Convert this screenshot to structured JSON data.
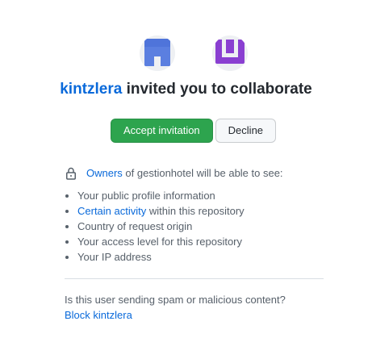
{
  "inviter": {
    "username": "kintzlera",
    "avatar_icon": "identicon-blue",
    "avatar_color": "#5b7fe0"
  },
  "organization": {
    "avatar_icon": "identicon-purple",
    "avatar_color": "#8a3fd1"
  },
  "headline": {
    "username": "kintzlera",
    "text": "invited you to collaborate"
  },
  "actions": {
    "accept_label": "Accept invitation",
    "decline_label": "Decline"
  },
  "visibility": {
    "icon": "lock-icon",
    "owners_link": "Owners",
    "text": "of gestionhotel will be able to see:"
  },
  "permissions": [
    {
      "text": "Your public profile information"
    },
    {
      "link": "Certain activity",
      "text": "within this repository"
    },
    {
      "text": "Country of request origin"
    },
    {
      "text": "Your access level for this repository"
    },
    {
      "text": "Your IP address"
    }
  ],
  "report": {
    "question": "Is this user sending spam or malicious content?",
    "block_link": "Block kintzlera"
  },
  "colors": {
    "link": "#0969da",
    "primary_button": "#2da44e",
    "muted_text": "#57606a"
  }
}
